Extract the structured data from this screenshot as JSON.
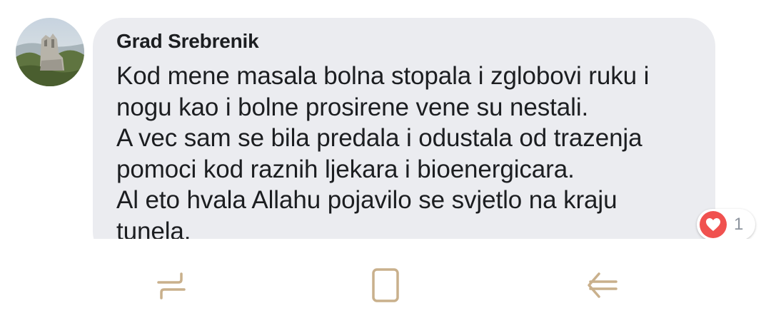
{
  "comment": {
    "author": "Grad Srebrenik",
    "text": "Kod mene masala bolna stopala i zglobovi ruku i\nnogu kao i bolne prosirene vene su nestali.\nA vec sam se bila predala i odustala od trazenja\npomoci kod raznih ljekara i bioenergicara.\nAl eto hvala Allahu pojavilo se svjetlo na kraju\ntunela.",
    "reaction_icon": "heart-icon",
    "reaction_count": "1"
  },
  "navbar": {
    "buttons": [
      "recent-apps-icon",
      "home-icon",
      "back-icon"
    ]
  },
  "colors": {
    "bubble": "#ebecf0",
    "text": "#1c1e21",
    "heart": "#f0514f",
    "nav_icon": "#c9b08c"
  }
}
